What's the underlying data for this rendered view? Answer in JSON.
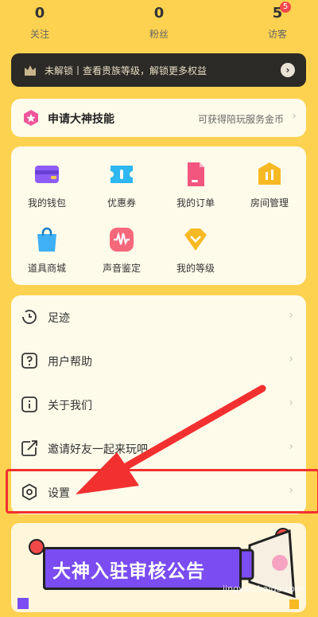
{
  "stats": [
    {
      "value": "0",
      "label": "关注"
    },
    {
      "value": "0",
      "label": "粉丝"
    },
    {
      "value": "5",
      "label": "访客",
      "badge": "5"
    }
  ],
  "vip_bar": {
    "text": "未解锁丨查看贵族等级，解锁更多权益"
  },
  "apply": {
    "title": "申请大神技能",
    "hint": "可获得陪玩服务金币"
  },
  "grid": [
    {
      "label": "我的钱包",
      "icon": "wallet-icon"
    },
    {
      "label": "优惠券",
      "icon": "coupon-icon"
    },
    {
      "label": "我的订单",
      "icon": "order-icon"
    },
    {
      "label": "房间管理",
      "icon": "room-management-icon"
    },
    {
      "label": "道具商城",
      "icon": "shopping-bag-icon"
    },
    {
      "label": "声音鉴定",
      "icon": "voice-wave-icon"
    },
    {
      "label": "我的等级",
      "icon": "level-icon"
    }
  ],
  "menu": [
    {
      "label": "足迹",
      "icon": "clock-icon"
    },
    {
      "label": "用户帮助",
      "icon": "help-icon"
    },
    {
      "label": "关于我们",
      "icon": "info-icon"
    },
    {
      "label": "邀请好友一起来玩吧",
      "icon": "share-icon"
    },
    {
      "label": "设置",
      "icon": "settings-icon"
    }
  ],
  "promo": {
    "text": "大神入驻审核公告"
  },
  "watermark": "jingyan.baidu.com",
  "colors": {
    "background": "#FDD250",
    "card": "#FFFBEA",
    "highlight": "#F23030",
    "promo_plate": "#7A4CF2"
  }
}
